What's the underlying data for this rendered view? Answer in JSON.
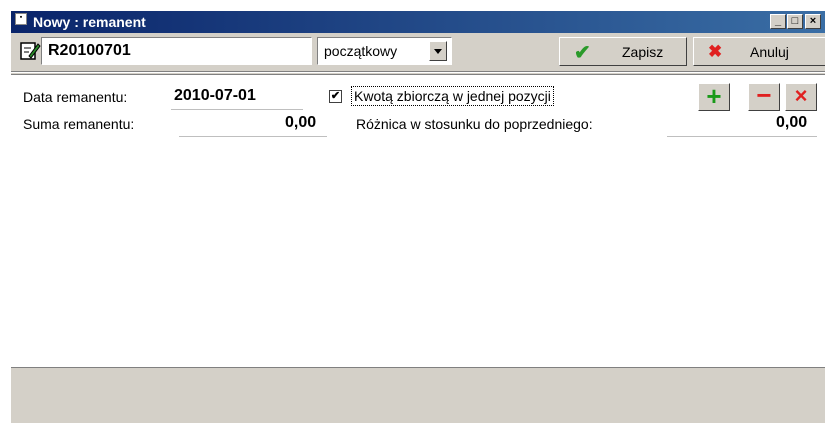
{
  "window": {
    "title": "Nowy : remanent",
    "controls": {
      "minimize": "_",
      "maximize": "□",
      "close": "×"
    }
  },
  "toolbar": {
    "doc_number": "R20100701",
    "type_value": "początkowy",
    "save_label": "Zapisz",
    "cancel_label": "Anuluj",
    "save_icon": "✔",
    "cancel_icon": "✖"
  },
  "form": {
    "date_label": "Data remanentu:",
    "date_value": "2010-07-01",
    "checkbox_label": "Kwotą zbiorczą w jednej pozycji",
    "checkbox_mark": "✔",
    "sum_label": "Suma remanentu:",
    "sum_value": "0,00",
    "diff_label": "Różnica w stosunku do poprzedniego:",
    "diff_value": "0,00"
  },
  "row_buttons": {
    "add": "+",
    "remove": "−",
    "delete": "×"
  },
  "colors": {
    "title_start": "#0a246a",
    "title_end": "#3a6ea5",
    "green": "#1a9a1a",
    "red": "#e02020"
  }
}
